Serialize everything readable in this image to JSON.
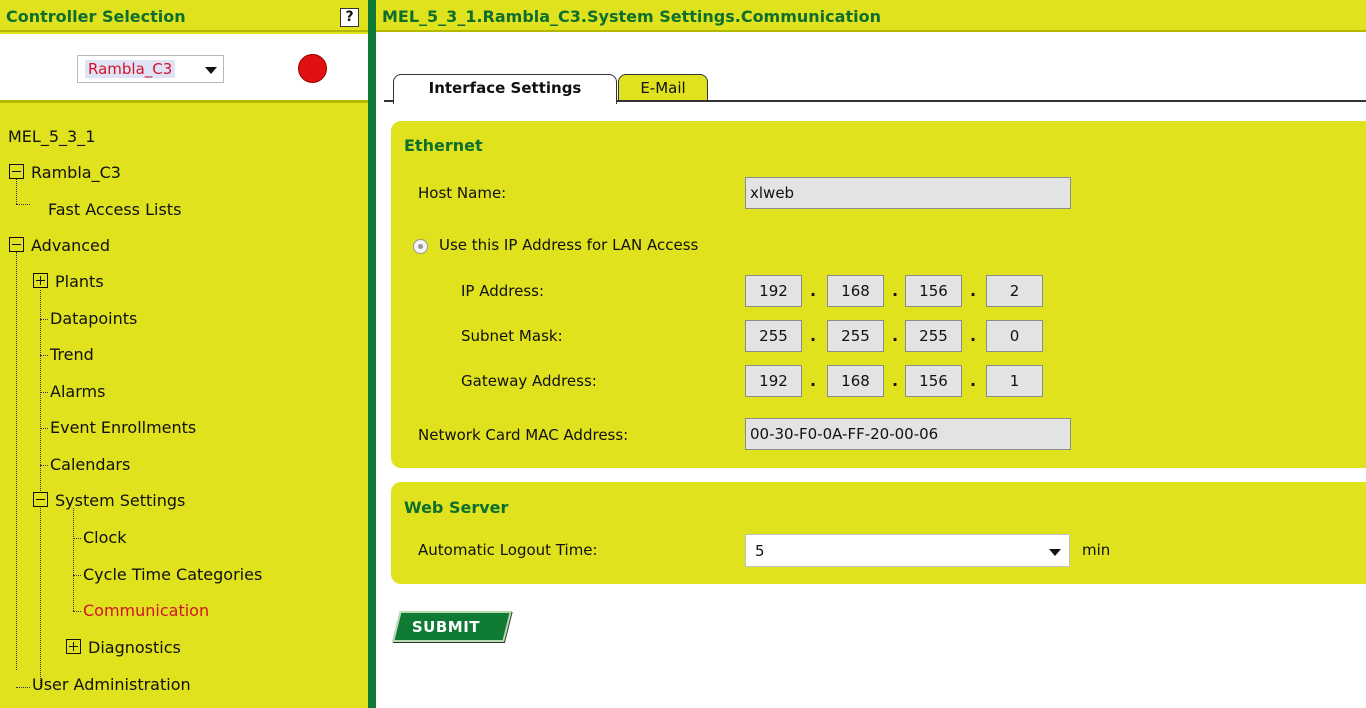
{
  "left": {
    "header_title": "Controller Selection",
    "help_label": "?",
    "controller_value": "Rambla_C3",
    "tree": {
      "root": "MEL_5_3_1",
      "controller": "Rambla_C3",
      "fast_access": "Fast Access Lists",
      "advanced": "Advanced",
      "plants": "Plants",
      "datapoints": "Datapoints",
      "trend": "Trend",
      "alarms": "Alarms",
      "event_enrollments": "Event Enrollments",
      "calendars": "Calendars",
      "system_settings": "System Settings",
      "clock": "Clock",
      "cycle_time": "Cycle Time Categories",
      "communication": "Communication",
      "diagnostics": "Diagnostics",
      "user_admin": "User Administration"
    }
  },
  "right": {
    "path": "MEL_5_3_1.Rambla_C3.System Settings.Communication",
    "tabs": [
      "Interface Settings",
      "E-Mail"
    ],
    "ethernet": {
      "title": "Ethernet",
      "host_name_label": "Host Name:",
      "host_name": "xlweb",
      "radio_label": "Use this IP Address for LAN Access",
      "ip_label": "IP Address:",
      "ip": [
        "192",
        "168",
        "156",
        "2"
      ],
      "subnet_label": "Subnet Mask:",
      "subnet": [
        "255",
        "255",
        "255",
        "0"
      ],
      "gateway_label": "Gateway Address:",
      "gateway": [
        "192",
        "168",
        "156",
        "1"
      ],
      "mac_label": "Network Card MAC Address:",
      "mac": "00-30-F0-0A-FF-20-00-06",
      "dot": "."
    },
    "web_server": {
      "title": "Web Server",
      "logout_label": "Automatic Logout Time:",
      "logout_value": "5",
      "unit": "min"
    },
    "submit_label": "SUBMIT"
  },
  "colors": {
    "panel": "#dfe21c",
    "accent_green": "#0e7a33",
    "selected_red": "#d2132b",
    "status_red": "#e01010"
  }
}
